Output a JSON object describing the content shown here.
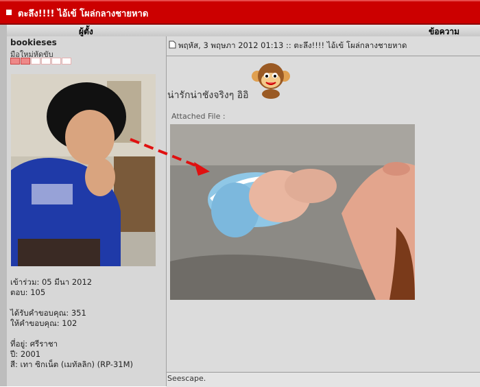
{
  "topic": {
    "title": "ตะลึง!!!! ไอ้เข้ โผล่กลางชายหาด"
  },
  "columns": {
    "author": "ผู้ตั้ง",
    "message": "ข้อความ"
  },
  "author": {
    "username": "bookieses",
    "rank": "มือใหม่หัดขับ",
    "stars_filled": 2,
    "stars_total": 6,
    "joined": "เข้าร่วม: 05 มีนา 2012",
    "posts": "ตอบ: 105",
    "thanks_received": "ได้รับคำขอบคุณ: 351",
    "thanks_given": "ให้คำขอบคุณ: 102",
    "location": "ที่อยู่: ศรีราชา",
    "year": "ปี: 2001",
    "color": "สี: เทา ซิกเน็ต (เมทัลลิก) (RP-31M)"
  },
  "post": {
    "date_line": "พฤหัส, 3 พฤษภา 2012 01:13 :: ตะลึง!!!! ไอ้เข้ โผล่กลางชายหาด",
    "message": "น่ารักน่าชังจริงๆ อิอิ",
    "attached_label": "Attached File :",
    "signature": "Seescape."
  },
  "colors": {
    "titlebar": "#cc0000",
    "panel": "#d7d7d7",
    "arrow": "#e01010"
  }
}
